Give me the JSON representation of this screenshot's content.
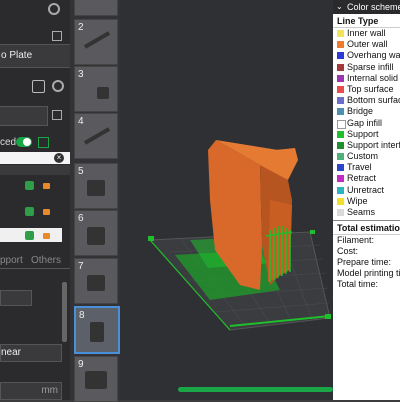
{
  "left_panel": {
    "plate_label": "o Plate",
    "toggle_label": "ced",
    "tabs": [
      "pport",
      "Others"
    ],
    "pattern_value": "near",
    "unit": "mm"
  },
  "thumbnails": [
    {
      "num": "2"
    },
    {
      "num": "3"
    },
    {
      "num": "4"
    },
    {
      "num": "5"
    },
    {
      "num": "6"
    },
    {
      "num": "7"
    },
    {
      "num": "8"
    },
    {
      "num": "9"
    }
  ],
  "legend": {
    "header": "Color scheme",
    "title": "Line Type",
    "items": [
      {
        "label": "Inner wall",
        "color": "#f2e35a"
      },
      {
        "label": "Outer wall",
        "color": "#ee7a2b"
      },
      {
        "label": "Overhang wall",
        "color": "#2b3ad6"
      },
      {
        "label": "Sparse infill",
        "color": "#a23a3a"
      },
      {
        "label": "Internal solid infill",
        "color": "#9b35b0"
      },
      {
        "label": "Top surface",
        "color": "#e84c4c"
      },
      {
        "label": "Bottom surface",
        "color": "#6a6fcf"
      },
      {
        "label": "Bridge",
        "color": "#4d8fb0"
      },
      {
        "label": "Gap infill",
        "color": "#ffffff"
      },
      {
        "label": "Support",
        "color": "#1fbe2b"
      },
      {
        "label": "Support interface",
        "color": "#1f8f2b"
      },
      {
        "label": "Custom",
        "color": "#4fb07a"
      },
      {
        "label": "Travel",
        "color": "#2c46c9"
      },
      {
        "label": "Retract",
        "color": "#c22ac2"
      },
      {
        "label": "Unretract",
        "color": "#2ab4c2"
      },
      {
        "label": "Wipe",
        "color": "#f0e02a"
      },
      {
        "label": "Seams",
        "color": "#d9d9d9"
      }
    ],
    "estimation_title": "Total estimation",
    "estimation_items": [
      "Filament:",
      "Cost:",
      "Prepare time:",
      "Model printing time:",
      "Total time:"
    ]
  }
}
